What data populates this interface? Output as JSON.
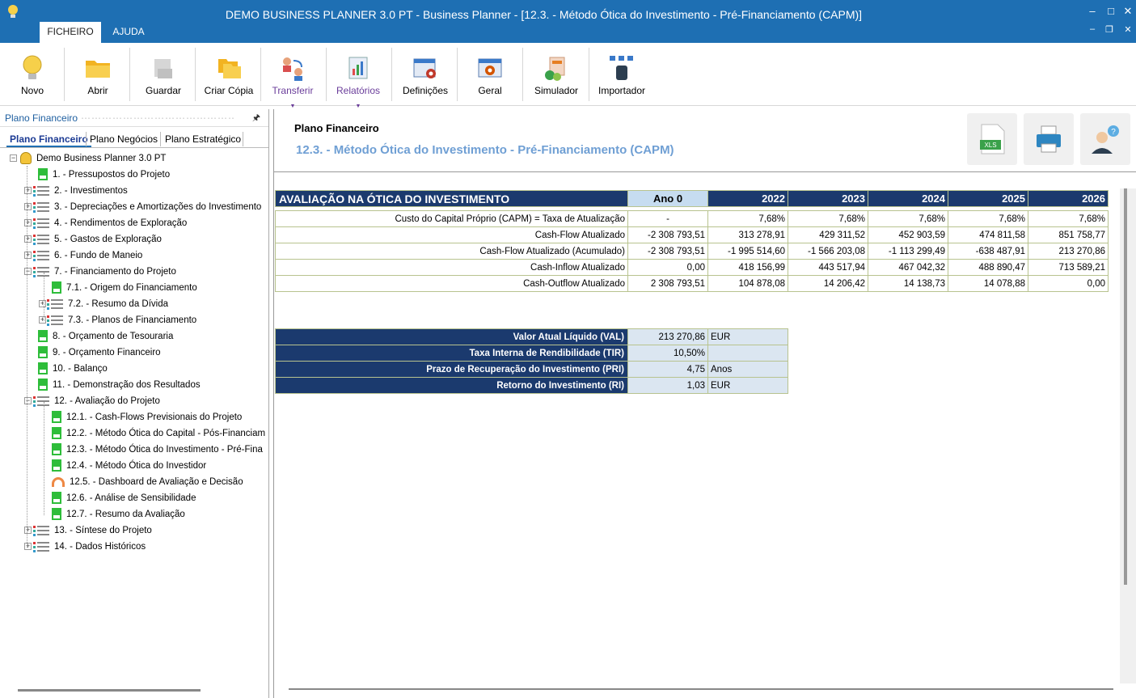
{
  "window": {
    "title": "DEMO BUSINESS PLANNER 3.0 PT - Business Planner - [12.3. - Método Ótica do Investimento - Pré-Financiamento (CAPM)]",
    "menu_tabs": [
      "FICHEIRO",
      "AJUDA"
    ],
    "controls": {
      "minimize": "–",
      "maximize": "□",
      "close": "✕",
      "restore": "❐"
    }
  },
  "ribbon": {
    "buttons": [
      {
        "label": "Novo",
        "icon": "lightbulb-icon"
      },
      {
        "label": "Abrir",
        "icon": "folder-icon"
      },
      {
        "label": "Guardar",
        "icon": "save-icon"
      },
      {
        "label": "Criar Cópia",
        "icon": "copy-icon"
      },
      {
        "label": "Transferir",
        "icon": "transfer-icon"
      },
      {
        "label": "Relatórios",
        "icon": "reports-icon"
      },
      {
        "label": "Definições",
        "icon": "settings-icon"
      },
      {
        "label": "Geral",
        "icon": "general-icon"
      },
      {
        "label": "Simulador",
        "icon": "simulator-icon"
      },
      {
        "label": "Importador",
        "icon": "importer-icon"
      }
    ]
  },
  "left_panel": {
    "header": "Plano Financeiro",
    "pin": "🖈",
    "tabs": [
      "Plano Financeiro",
      "Plano Negócios",
      "Plano Estratégico"
    ],
    "root": "Demo Business Planner 3.0 PT",
    "items": [
      {
        "label": "1. - Pressupostos do Projeto",
        "icon": "sheet",
        "level": 1,
        "expander": ""
      },
      {
        "label": "2. - Investimentos",
        "icon": "list",
        "level": 1,
        "expander": "+"
      },
      {
        "label": "3. - Depreciações e Amortizações do Investimento",
        "icon": "list",
        "level": 1,
        "expander": "+"
      },
      {
        "label": "4. - Rendimentos de Exploração",
        "icon": "list",
        "level": 1,
        "expander": "+"
      },
      {
        "label": "5. - Gastos de Exploração",
        "icon": "list",
        "level": 1,
        "expander": "+"
      },
      {
        "label": "6. - Fundo de Maneio",
        "icon": "list",
        "level": 1,
        "expander": "+"
      },
      {
        "label": "7. - Financiamento do Projeto",
        "icon": "list",
        "level": 1,
        "expander": "−"
      },
      {
        "label": "7.1. - Origem do Financiamento",
        "icon": "sheet",
        "level": 2,
        "expander": ""
      },
      {
        "label": "7.2. - Resumo da Dívida",
        "icon": "list",
        "level": 2,
        "expander": "+"
      },
      {
        "label": "7.3. - Planos de Financiamento",
        "icon": "list",
        "level": 2,
        "expander": "+"
      },
      {
        "label": "8. - Orçamento de Tesouraria",
        "icon": "sheet",
        "level": 1,
        "expander": ""
      },
      {
        "label": "9. - Orçamento Financeiro",
        "icon": "sheet",
        "level": 1,
        "expander": ""
      },
      {
        "label": "10. - Balanço",
        "icon": "sheet",
        "level": 1,
        "expander": ""
      },
      {
        "label": "11. - Demonstração dos Resultados",
        "icon": "sheet",
        "level": 1,
        "expander": ""
      },
      {
        "label": "12. - Avaliação do Projeto",
        "icon": "list",
        "level": 1,
        "expander": "−"
      },
      {
        "label": "12.1. - Cash-Flows Previsionais do Projeto",
        "icon": "sheet",
        "level": 2,
        "expander": ""
      },
      {
        "label": "12.2. - Método Ótica do Capital - Pós-Financiam",
        "icon": "sheet",
        "level": 2,
        "expander": ""
      },
      {
        "label": "12.3. - Método Ótica do Investimento - Pré-Fina",
        "icon": "sheet",
        "level": 2,
        "expander": ""
      },
      {
        "label": "12.4. - Método Ótica do Investidor",
        "icon": "sheet",
        "level": 2,
        "expander": ""
      },
      {
        "label": "12.5. - Dashboard de Avaliação e Decisão",
        "icon": "gauge",
        "level": 2,
        "expander": ""
      },
      {
        "label": "12.6. - Análise de Sensibilidade",
        "icon": "sheet",
        "level": 2,
        "expander": ""
      },
      {
        "label": "12.7. - Resumo da Avaliação",
        "icon": "sheet",
        "level": 2,
        "expander": ""
      },
      {
        "label": "13. - Síntese do Projeto",
        "icon": "list",
        "level": 1,
        "expander": "+"
      },
      {
        "label": "14. - Dados Históricos",
        "icon": "list",
        "level": 1,
        "expander": "+"
      }
    ]
  },
  "content": {
    "title": "Plano Financeiro",
    "subtitle": "12.3. - Método Ótica do Investimento - Pré-Financiamento (CAPM)",
    "header_buttons": [
      "xls-export-icon",
      "print-icon",
      "help-user-icon"
    ],
    "xls_text": "XLS",
    "table": {
      "title": "AVALIAÇÃO NA ÓTICA DO INVESTIMENTO",
      "columns": [
        "Ano 0",
        "2022",
        "2023",
        "2024",
        "2025",
        "2026"
      ],
      "rows": [
        {
          "label": "Custo do Capital Próprio (CAPM) = Taxa de Atualização",
          "values": [
            "-",
            "7,68%",
            "7,68%",
            "7,68%",
            "7,68%",
            "7,68%"
          ]
        },
        {
          "label": "Cash-Flow Atualizado",
          "values": [
            "-2 308 793,51",
            "313 278,91",
            "429 311,52",
            "452 903,59",
            "474 811,58",
            "851 758,77"
          ]
        },
        {
          "label": "Cash-Flow Atualizado (Acumulado)",
          "values": [
            "-2 308 793,51",
            "-1 995 514,60",
            "-1 566 203,08",
            "-1 113 299,49",
            "-638 487,91",
            "213 270,86"
          ]
        },
        {
          "label": "Cash-Inflow Atualizado",
          "values": [
            "0,00",
            "418 156,99",
            "443 517,94",
            "467 042,32",
            "488 890,47",
            "713 589,21"
          ]
        },
        {
          "label": "Cash-Outflow Atualizado",
          "values": [
            "2 308 793,51",
            "104 878,08",
            "14 206,42",
            "14 138,73",
            "14 078,88",
            "0,00"
          ]
        }
      ]
    },
    "summary": [
      {
        "label": "Valor Atual Líquido (VAL)",
        "value": "213 270,86",
        "unit": "EUR"
      },
      {
        "label": "Taxa Interna de Rendibilidade (TIR)",
        "value": "10,50%",
        "unit": ""
      },
      {
        "label": "Prazo de Recuperação do Investimento (PRI)",
        "value": "4,75",
        "unit": "Anos"
      },
      {
        "label": "Retorno do Investimento (RI)",
        "value": "1,03",
        "unit": "EUR"
      }
    ]
  },
  "colors": {
    "titlebar": "#1e6fb3",
    "table_header": "#1b3a6e",
    "ano0_header": "#c6dcf0",
    "subtitle": "#6f9fd4",
    "tree_sheet_icon": "#2ebd3a"
  }
}
